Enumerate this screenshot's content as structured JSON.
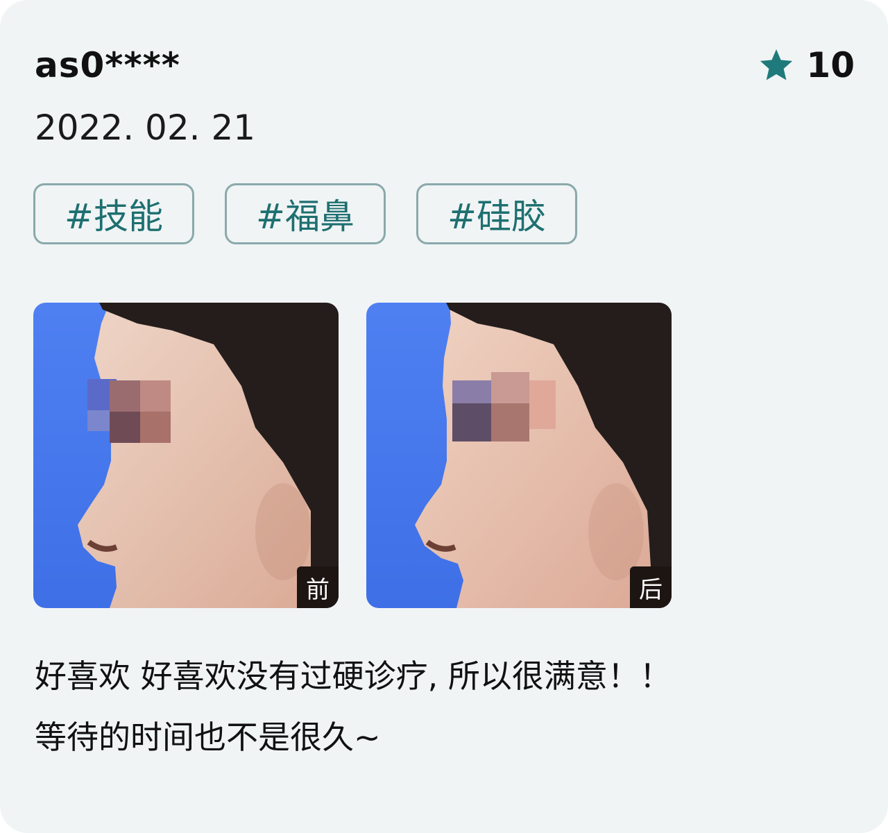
{
  "review": {
    "username": "as0****",
    "rating": {
      "icon": "star-icon",
      "value": "10",
      "color": "#1e7a7b"
    },
    "date": "2022. 02. 21",
    "tags": [
      {
        "label": "#技能"
      },
      {
        "label": "#福鼻"
      },
      {
        "label": "#硅胶"
      }
    ],
    "photos": [
      {
        "label": "前"
      },
      {
        "label": "后"
      }
    ],
    "text_lines": [
      "好喜欢 好喜欢没有过硬诊疗, 所以很满意！！",
      "等待的时间也不是很久~"
    ]
  },
  "colors": {
    "card_background": "#f0f4f5",
    "tag_border": "#8aa9ab",
    "tag_text": "#1e6f70",
    "photo_background": "#4a78ee"
  }
}
